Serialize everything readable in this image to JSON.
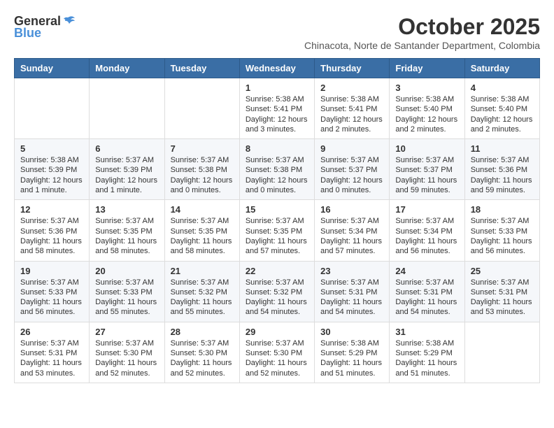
{
  "header": {
    "logo_line1": "General",
    "logo_line2": "Blue",
    "month_year": "October 2025",
    "location": "Chinacota, Norte de Santander Department, Colombia"
  },
  "days_of_week": [
    "Sunday",
    "Monday",
    "Tuesday",
    "Wednesday",
    "Thursday",
    "Friday",
    "Saturday"
  ],
  "weeks": [
    [
      {
        "day": "",
        "content": ""
      },
      {
        "day": "",
        "content": ""
      },
      {
        "day": "",
        "content": ""
      },
      {
        "day": "1",
        "content": "Sunrise: 5:38 AM\nSunset: 5:41 PM\nDaylight: 12 hours and 3 minutes."
      },
      {
        "day": "2",
        "content": "Sunrise: 5:38 AM\nSunset: 5:41 PM\nDaylight: 12 hours and 2 minutes."
      },
      {
        "day": "3",
        "content": "Sunrise: 5:38 AM\nSunset: 5:40 PM\nDaylight: 12 hours and 2 minutes."
      },
      {
        "day": "4",
        "content": "Sunrise: 5:38 AM\nSunset: 5:40 PM\nDaylight: 12 hours and 2 minutes."
      }
    ],
    [
      {
        "day": "5",
        "content": "Sunrise: 5:38 AM\nSunset: 5:39 PM\nDaylight: 12 hours and 1 minute."
      },
      {
        "day": "6",
        "content": "Sunrise: 5:37 AM\nSunset: 5:39 PM\nDaylight: 12 hours and 1 minute."
      },
      {
        "day": "7",
        "content": "Sunrise: 5:37 AM\nSunset: 5:38 PM\nDaylight: 12 hours and 0 minutes."
      },
      {
        "day": "8",
        "content": "Sunrise: 5:37 AM\nSunset: 5:38 PM\nDaylight: 12 hours and 0 minutes."
      },
      {
        "day": "9",
        "content": "Sunrise: 5:37 AM\nSunset: 5:37 PM\nDaylight: 12 hours and 0 minutes."
      },
      {
        "day": "10",
        "content": "Sunrise: 5:37 AM\nSunset: 5:37 PM\nDaylight: 11 hours and 59 minutes."
      },
      {
        "day": "11",
        "content": "Sunrise: 5:37 AM\nSunset: 5:36 PM\nDaylight: 11 hours and 59 minutes."
      }
    ],
    [
      {
        "day": "12",
        "content": "Sunrise: 5:37 AM\nSunset: 5:36 PM\nDaylight: 11 hours and 58 minutes."
      },
      {
        "day": "13",
        "content": "Sunrise: 5:37 AM\nSunset: 5:35 PM\nDaylight: 11 hours and 58 minutes."
      },
      {
        "day": "14",
        "content": "Sunrise: 5:37 AM\nSunset: 5:35 PM\nDaylight: 11 hours and 58 minutes."
      },
      {
        "day": "15",
        "content": "Sunrise: 5:37 AM\nSunset: 5:35 PM\nDaylight: 11 hours and 57 minutes."
      },
      {
        "day": "16",
        "content": "Sunrise: 5:37 AM\nSunset: 5:34 PM\nDaylight: 11 hours and 57 minutes."
      },
      {
        "day": "17",
        "content": "Sunrise: 5:37 AM\nSunset: 5:34 PM\nDaylight: 11 hours and 56 minutes."
      },
      {
        "day": "18",
        "content": "Sunrise: 5:37 AM\nSunset: 5:33 PM\nDaylight: 11 hours and 56 minutes."
      }
    ],
    [
      {
        "day": "19",
        "content": "Sunrise: 5:37 AM\nSunset: 5:33 PM\nDaylight: 11 hours and 56 minutes."
      },
      {
        "day": "20",
        "content": "Sunrise: 5:37 AM\nSunset: 5:33 PM\nDaylight: 11 hours and 55 minutes."
      },
      {
        "day": "21",
        "content": "Sunrise: 5:37 AM\nSunset: 5:32 PM\nDaylight: 11 hours and 55 minutes."
      },
      {
        "day": "22",
        "content": "Sunrise: 5:37 AM\nSunset: 5:32 PM\nDaylight: 11 hours and 54 minutes."
      },
      {
        "day": "23",
        "content": "Sunrise: 5:37 AM\nSunset: 5:31 PM\nDaylight: 11 hours and 54 minutes."
      },
      {
        "day": "24",
        "content": "Sunrise: 5:37 AM\nSunset: 5:31 PM\nDaylight: 11 hours and 54 minutes."
      },
      {
        "day": "25",
        "content": "Sunrise: 5:37 AM\nSunset: 5:31 PM\nDaylight: 11 hours and 53 minutes."
      }
    ],
    [
      {
        "day": "26",
        "content": "Sunrise: 5:37 AM\nSunset: 5:31 PM\nDaylight: 11 hours and 53 minutes."
      },
      {
        "day": "27",
        "content": "Sunrise: 5:37 AM\nSunset: 5:30 PM\nDaylight: 11 hours and 52 minutes."
      },
      {
        "day": "28",
        "content": "Sunrise: 5:37 AM\nSunset: 5:30 PM\nDaylight: 11 hours and 52 minutes."
      },
      {
        "day": "29",
        "content": "Sunrise: 5:37 AM\nSunset: 5:30 PM\nDaylight: 11 hours and 52 minutes."
      },
      {
        "day": "30",
        "content": "Sunrise: 5:38 AM\nSunset: 5:29 PM\nDaylight: 11 hours and 51 minutes."
      },
      {
        "day": "31",
        "content": "Sunrise: 5:38 AM\nSunset: 5:29 PM\nDaylight: 11 hours and 51 minutes."
      },
      {
        "day": "",
        "content": ""
      }
    ]
  ]
}
